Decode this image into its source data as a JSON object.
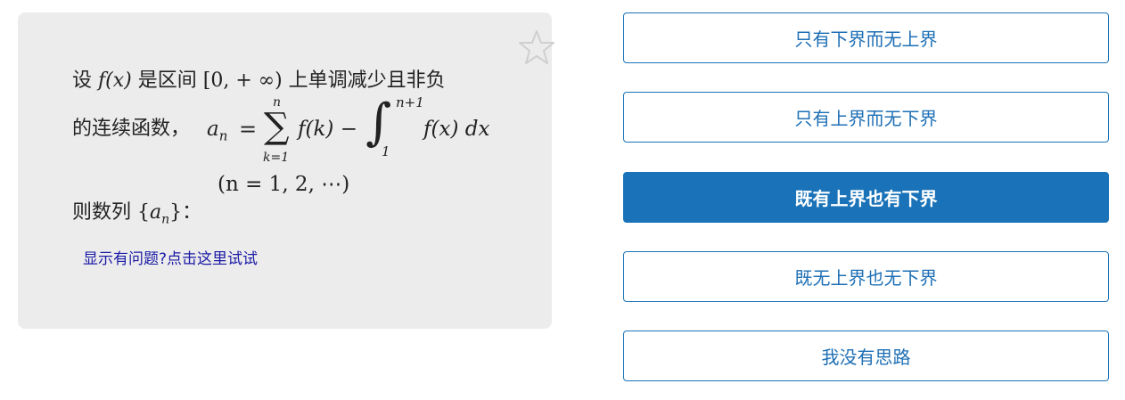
{
  "question": {
    "line1_prefix": "设",
    "line1_fx": "f(x)",
    "line1_mid": "是区间",
    "line1_interval": "[0, + ∞)",
    "line1_suffix": "上单调减少且非负",
    "line2_prefix": "的连续函数，",
    "formula": {
      "lhs": "a",
      "lhs_sub": "n",
      "equals": "=",
      "sum_top": "n",
      "sum_bottom": "k=1",
      "sum_term": "f(k) −",
      "int_top": "n+1",
      "int_bottom": "1",
      "int_term": "f(x) dx"
    },
    "condition": "(n = 1, 2, ⋯)",
    "line4_prefix": "则数列",
    "seq_open": "{",
    "seq_var": "a",
    "seq_sub": "n",
    "seq_close": "}：",
    "help_link": "显示有问题?点击这里试试"
  },
  "icons": {
    "favorite": "star-outline-icon"
  },
  "options": [
    {
      "label": "只有下界而无上界",
      "selected": false
    },
    {
      "label": "只有上界而无下界",
      "selected": false
    },
    {
      "label": "既有上界也有下界",
      "selected": true
    },
    {
      "label": "既无上界也无下界",
      "selected": false
    },
    {
      "label": "我没有思路",
      "selected": false
    }
  ],
  "colors": {
    "accent": "#1a73b8",
    "card_bg": "#ececec",
    "link": "#1a1aa6"
  }
}
